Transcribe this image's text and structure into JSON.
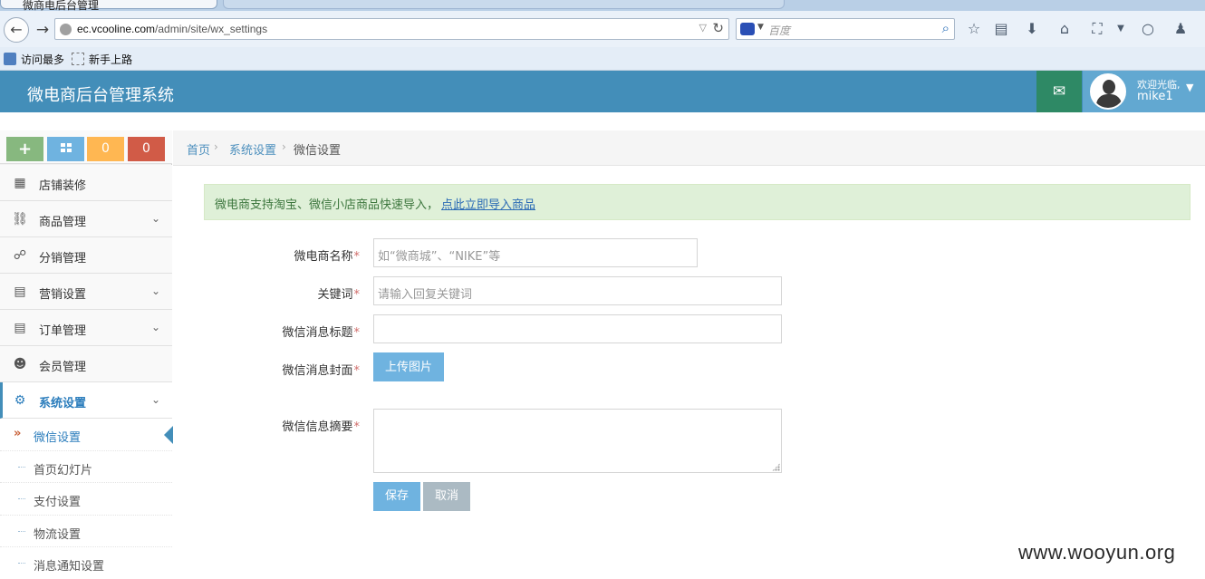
{
  "browser": {
    "tab_title": "微商电后台管理",
    "url_host": "ec.vcooline.com",
    "url_path": "/admin/site/wx_settings",
    "search_placeholder": "百度",
    "bookmarks": [
      "访问最多",
      "新手上路"
    ]
  },
  "header": {
    "title": "微电商后台管理系统",
    "welcome": "欢迎光临,",
    "username": "mike1"
  },
  "shortcuts": [
    {
      "label": "+",
      "color": "#87b87f"
    },
    {
      "label": "",
      "icon": "grid-icon",
      "color": "#6fb3e0"
    },
    {
      "label": "0",
      "color": "#ffb752"
    },
    {
      "label": "0",
      "color": "#d15b47"
    }
  ],
  "sidebar": {
    "items": [
      {
        "label": "店铺装修",
        "icon": "grid-icon",
        "has_children": false
      },
      {
        "label": "商品管理",
        "icon": "cart-icon",
        "has_children": true
      },
      {
        "label": "分销管理",
        "icon": "share-icon",
        "has_children": false
      },
      {
        "label": "营销设置",
        "icon": "document-icon",
        "has_children": true
      },
      {
        "label": "订单管理",
        "icon": "document-icon",
        "has_children": true
      },
      {
        "label": "会员管理",
        "icon": "users-icon",
        "has_children": false
      },
      {
        "label": "系统设置",
        "icon": "gear-icon",
        "has_children": true,
        "active": true
      }
    ],
    "submenu": [
      {
        "label": "微信设置",
        "current": true
      },
      {
        "label": "首页幻灯片"
      },
      {
        "label": "支付设置"
      },
      {
        "label": "物流设置"
      },
      {
        "label": "消息通知设置"
      }
    ]
  },
  "breadcrumb": [
    "首页",
    "系统设置",
    "微信设置"
  ],
  "alert": {
    "text": "微电商支持淘宝、微信小店商品快速导入，",
    "link": "点此立即导入商品"
  },
  "form": {
    "name_label": "微电商名称",
    "name_placeholder": "如“微商城”、“NIKE”等",
    "keyword_label": "关键词",
    "keyword_placeholder": "请输入回复关键词",
    "msg_title_label": "微信消息标题",
    "msg_title_value": "",
    "cover_label": "微信消息封面",
    "upload_button": "上传图片",
    "summary_label": "微信信息摘要",
    "summary_value": "",
    "required_mark": "*",
    "save_button": "保存",
    "cancel_button": "取消"
  },
  "watermark": "www.wooyun.org"
}
